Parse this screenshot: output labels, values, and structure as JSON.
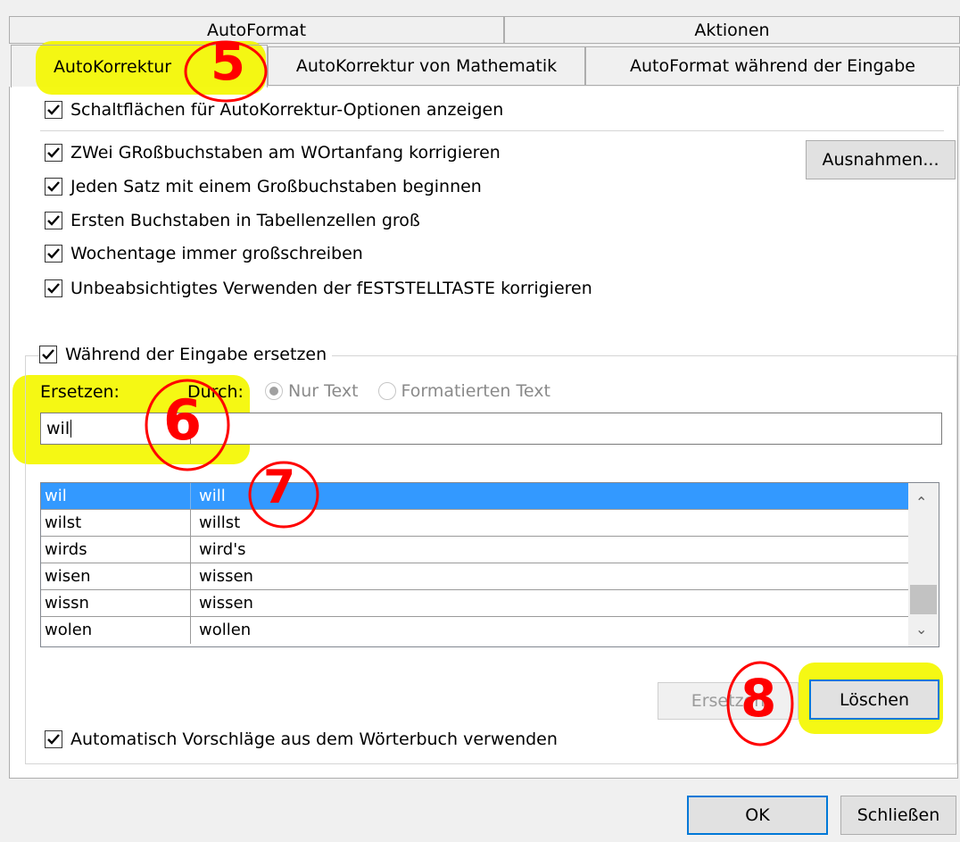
{
  "tabs_row1": [
    "AutoFormat",
    "Aktionen"
  ],
  "tabs_row2": [
    "AutoKorrektur",
    "AutoKorrektur von Mathematik",
    "AutoFormat während der Eingabe"
  ],
  "options": {
    "show_buttons": "Schaltflächen für AutoKorrektur-Optionen anzeigen",
    "two_caps": "ZWei GRoßbuchstaben am WOrtanfang korrigieren",
    "sentence_cap": "Jeden Satz mit einem Großbuchstaben beginnen",
    "table_cells": "Ersten Buchstaben in Tabellenzellen groß",
    "weekdays": "Wochentage immer großschreiben",
    "capslock": "Unbeabsichtigtes Verwenden der fESTSTELLTASTE korrigieren"
  },
  "exceptions_button": "Ausnahmen...",
  "replace_group": {
    "checkbox_label": "Während der Eingabe ersetzen",
    "replace_label": "Ersetzen:",
    "with_label": "Durch:",
    "radio_plain": "Nur Text",
    "radio_formatted": "Formatierten Text",
    "replace_value": "wil",
    "with_value": ""
  },
  "table_rows": [
    {
      "from": "wil",
      "to": "will"
    },
    {
      "from": "wilst",
      "to": "willst"
    },
    {
      "from": "wirds",
      "to": "wird's"
    },
    {
      "from": "wisen",
      "to": "wissen"
    },
    {
      "from": "wissn",
      "to": "wissen"
    },
    {
      "from": "wolen",
      "to": "wollen"
    }
  ],
  "replace_button": "Ersetzen",
  "delete_button": "Löschen",
  "dictionary_suggestions": "Automatisch Vorschläge aus dem Wörterbuch verwenden",
  "ok_button": "OK",
  "close_button": "Schließen",
  "annotations": [
    "5",
    "6",
    "7",
    "8"
  ],
  "colors": {
    "highlight": "#f4f700",
    "annotation": "#ff0000",
    "selection": "#3399ff"
  }
}
